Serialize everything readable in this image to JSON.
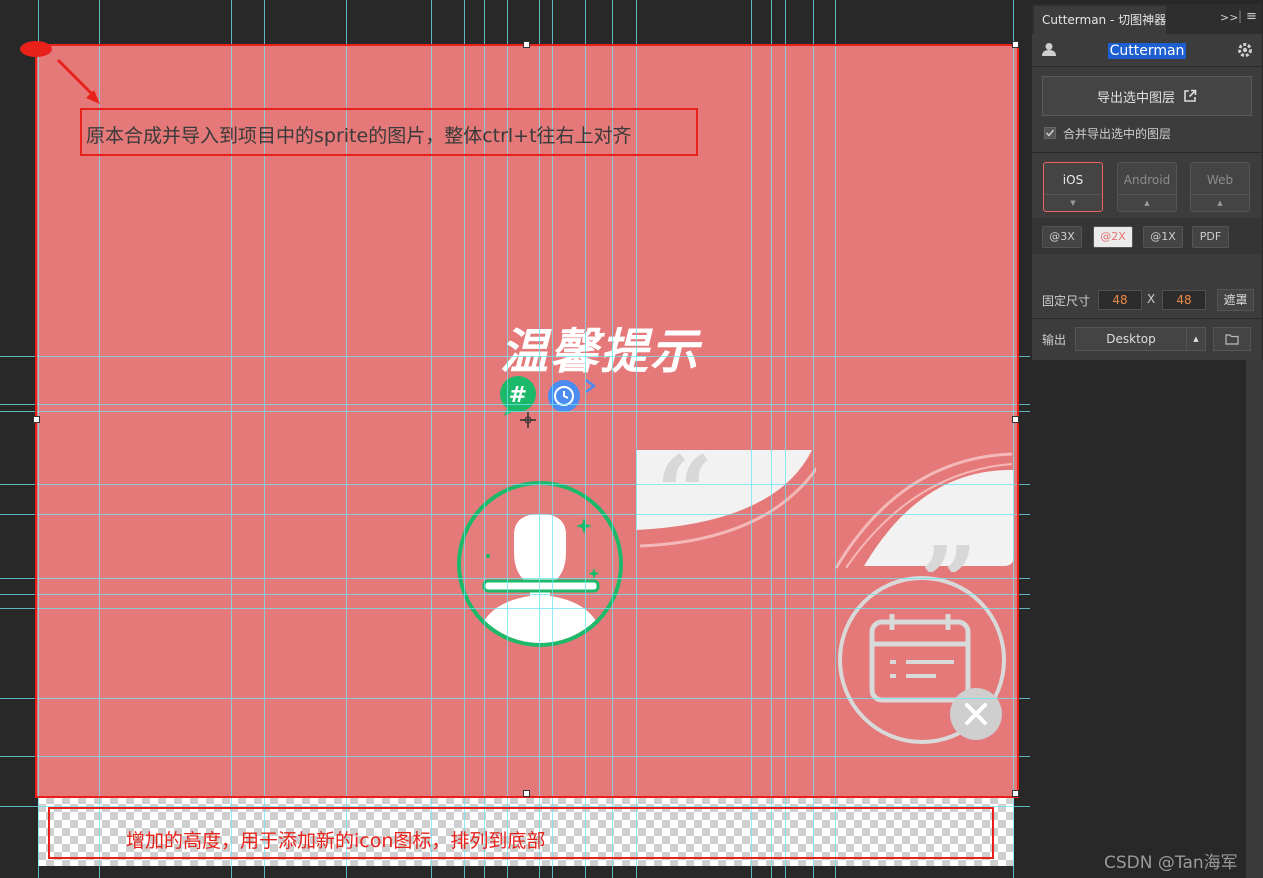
{
  "annotations": {
    "top": "原本合成并导入到项目中的sprite的图片，整体ctrl+t往右上对齐",
    "bottom": "增加的高度，用于添加新的icon图标，排列到底部"
  },
  "sprite": {
    "title": "温馨提示"
  },
  "panel": {
    "tab_title": "Cutterman - 切图神器",
    "username": "Cutterman",
    "export_button": "导出选中图层",
    "merge_checkbox_label": "合并导出选中的图层",
    "merge_checked": true,
    "platforms": [
      "iOS",
      "Android",
      "Web"
    ],
    "active_platform": "iOS",
    "scales": [
      "@3X",
      "@2X",
      "@1X",
      "PDF"
    ],
    "active_scale": "@2X",
    "fixed_size_label": "固定尺寸",
    "width": "48",
    "x_label": "X",
    "height": "48",
    "mask_button": "遮罩",
    "output_label": "输出",
    "output_value": "Desktop"
  },
  "watermark": "CSDN @Tan海军",
  "colors": {
    "artboard": "#e57878",
    "annotation_red": "#e8221a",
    "guide_cyan": "#6ee6f5",
    "panel_bg": "#3c3c3c",
    "accent_green": "#1db96a",
    "accent_blue": "#4c8cf0"
  }
}
